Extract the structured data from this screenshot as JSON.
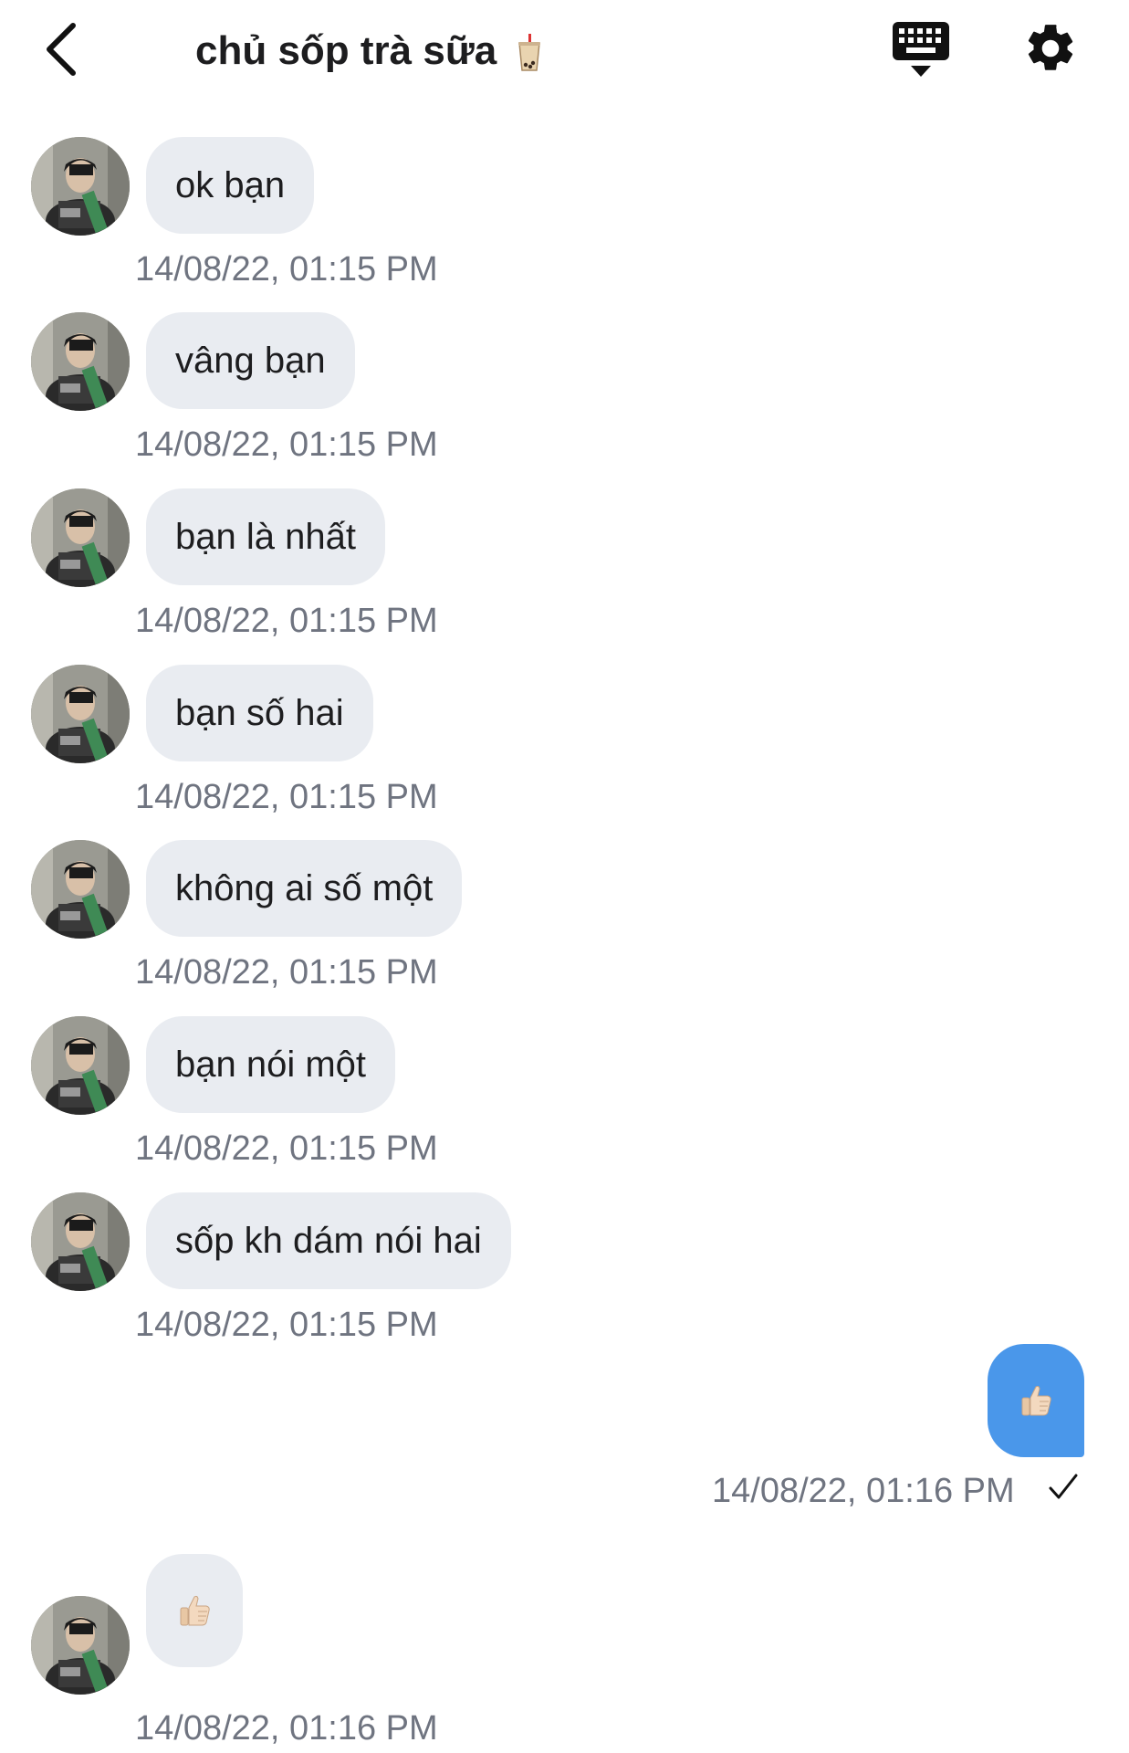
{
  "header": {
    "title": "chủ sốp trà sữa",
    "title_emoji_icon": "bubble-tea-icon",
    "back_icon": "chevron-left-icon",
    "keyboard_icon": "keyboard-icon",
    "settings_icon": "gear-icon"
  },
  "messages": [
    {
      "direction": "incoming",
      "text": "ok bạn",
      "timestamp": "14/08/22, 01:15 PM"
    },
    {
      "direction": "incoming",
      "text": "vâng bạn",
      "timestamp": "14/08/22, 01:15 PM"
    },
    {
      "direction": "incoming",
      "text": "bạn là nhất",
      "timestamp": "14/08/22, 01:15 PM"
    },
    {
      "direction": "incoming",
      "text": "bạn số hai",
      "timestamp": "14/08/22, 01:15 PM"
    },
    {
      "direction": "incoming",
      "text": "không ai số một",
      "timestamp": "14/08/22, 01:15 PM"
    },
    {
      "direction": "incoming",
      "text": "bạn nói một",
      "timestamp": "14/08/22, 01:15 PM"
    },
    {
      "direction": "incoming",
      "text": "sốp kh dám nói hai",
      "timestamp": "14/08/22, 01:15 PM"
    },
    {
      "direction": "outgoing",
      "content_icon": "thumbs-up-icon",
      "timestamp": "14/08/22, 01:16 PM",
      "status_icon": "checkmark-icon"
    },
    {
      "direction": "incoming",
      "content_icon": "thumbs-up-icon",
      "timestamp": "14/08/22, 01:16 PM"
    }
  ],
  "colors": {
    "incoming_bubble": "#e9ecf1",
    "outgoing_bubble": "#4a97ea",
    "timestamp": "#6f7480"
  }
}
